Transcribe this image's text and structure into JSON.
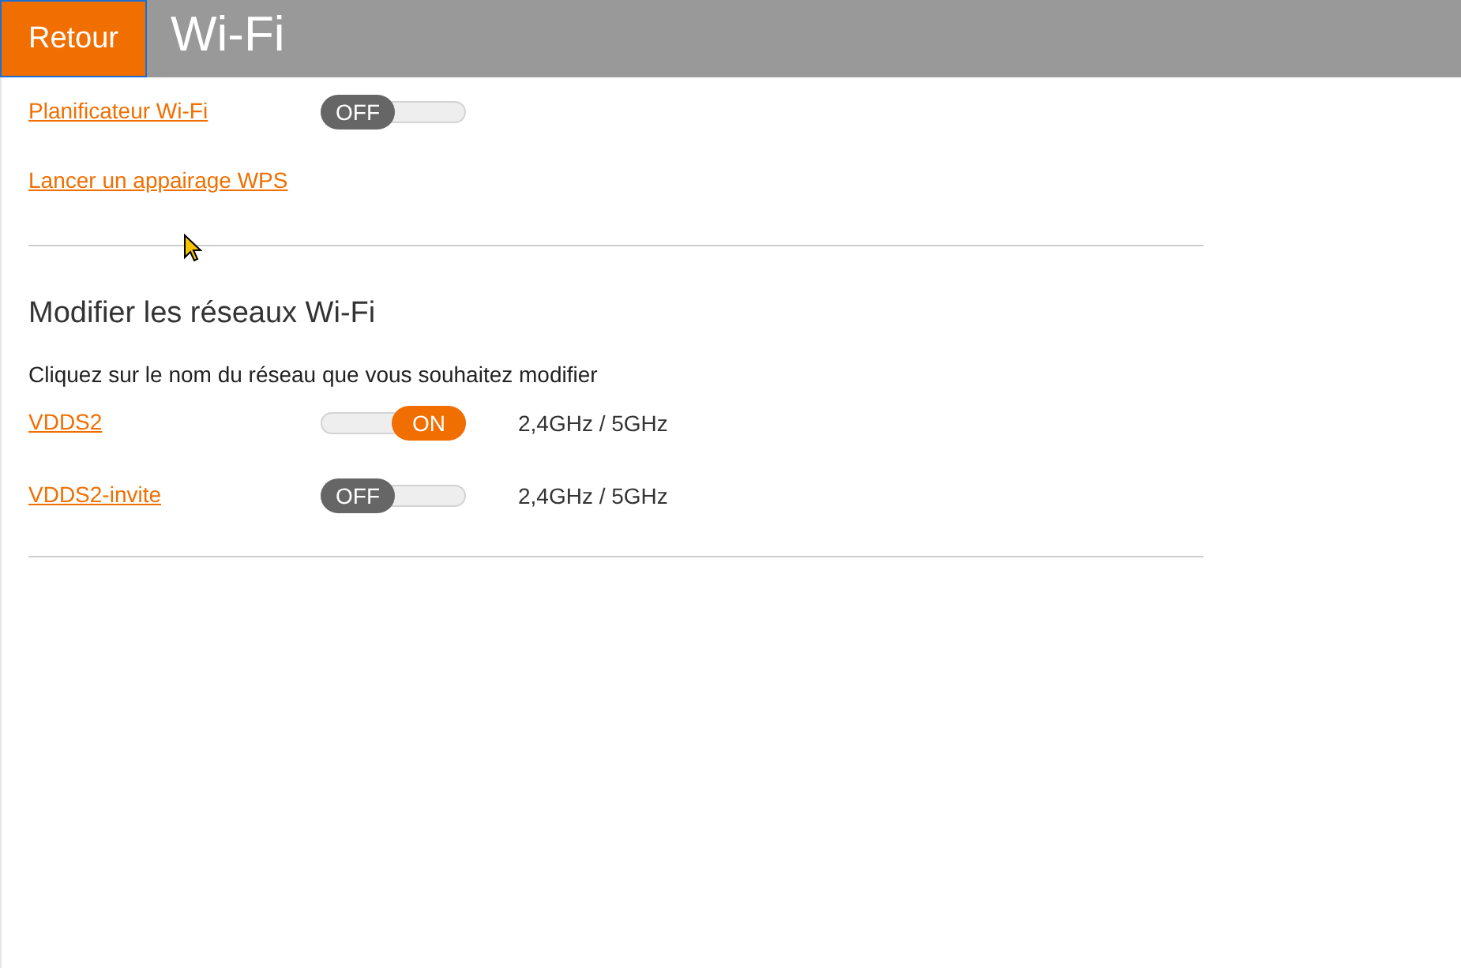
{
  "header": {
    "back_button": "Retour",
    "title": "Wi-Fi"
  },
  "options": [
    {
      "label": "Planificateur Wi-Fi",
      "kind": "toggle",
      "toggle": {
        "on": false,
        "label": "OFF"
      }
    },
    {
      "label": "Lancer un appairage WPS",
      "kind": "link"
    }
  ],
  "networks_section": {
    "heading": "Modifier les réseaux Wi-Fi",
    "instruction": "Cliquez sur le nom du réseau que vous souhaitez modifier",
    "networks": [
      {
        "name": "VDDS2",
        "toggle": {
          "on": true,
          "label": "ON"
        },
        "bands": "2,4GHz / 5GHz"
      },
      {
        "name": "VDDS2-invite",
        "toggle": {
          "on": false,
          "label": "OFF"
        },
        "bands": "2,4GHz / 5GHz"
      }
    ]
  }
}
